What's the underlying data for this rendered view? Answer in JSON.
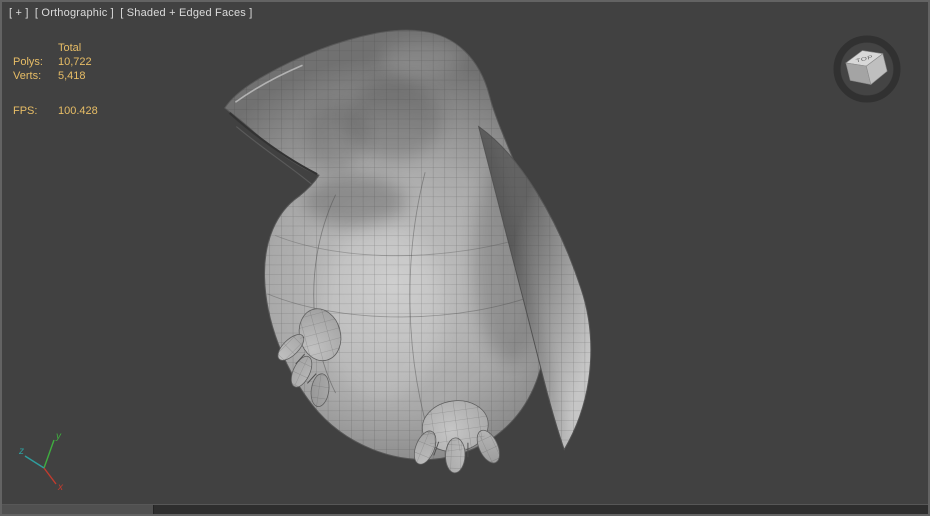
{
  "viewport_label": {
    "general": "[ + ]",
    "pov": "[ Orthographic ]",
    "shading": "[ Shaded + Edged Faces ]"
  },
  "statistics": {
    "total_header": "Total",
    "polys_label": "Polys:",
    "polys_value": "10,722",
    "verts_label": "Verts:",
    "verts_value": "5,418",
    "fps_label": "FPS:",
    "fps_value": "100.428"
  },
  "viewcube": {
    "top_face": "TOP"
  },
  "axis_tripod": {
    "x_label": "x",
    "y_label": "y",
    "z_label": "z"
  },
  "colors": {
    "viewport_background": "#414141",
    "viewport_label_text": "#dcdcdc",
    "statistics_text": "#e7bd66",
    "axis_x": "#c23b2e",
    "axis_y": "#3fae3f",
    "axis_z": "#2f9e9e",
    "model_shade_light": "#c8c8c8",
    "model_shade_dark": "#717171",
    "wireframe_line": "#3c3c3c"
  }
}
